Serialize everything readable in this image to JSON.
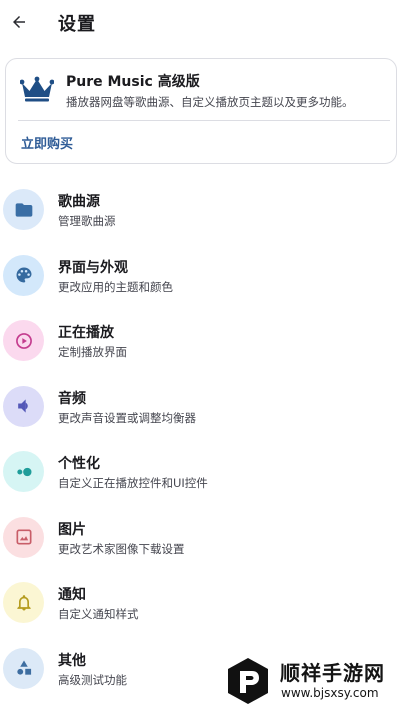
{
  "header": {
    "title": "设置",
    "back_icon": "arrow-back-icon"
  },
  "pro_card": {
    "title": "Pure Music 高级版",
    "description": "播放器网盘等歌曲源、自定义播放页主题以及更多功能。",
    "buy_label": "立即购买",
    "icon": "crown-icon",
    "accent_color": "#1f4e85"
  },
  "settings": {
    "items": [
      {
        "title": "歌曲源",
        "subtitle": "管理歌曲源",
        "icon": "folder-icon",
        "bg_color": "#dbe9f9",
        "icon_color": "#3a6ea5"
      },
      {
        "title": "界面与外观",
        "subtitle": "更改应用的主题和颜色",
        "icon": "palette-icon",
        "bg_color": "#d3e8fb",
        "icon_color": "#356a9f"
      },
      {
        "title": "正在播放",
        "subtitle": "定制播放界面",
        "icon": "play-circle-icon",
        "bg_color": "#fbd9ee",
        "icon_color": "#c43c8e"
      },
      {
        "title": "音频",
        "subtitle": "更改声音设置或调整均衡器",
        "icon": "volume-icon",
        "bg_color": "#dcdcf8",
        "icon_color": "#5458b8"
      },
      {
        "title": "个性化",
        "subtitle": "自定义正在播放控件和UI控件",
        "icon": "toggle-icon",
        "bg_color": "#d6f5f4",
        "icon_color": "#1f9d9a"
      },
      {
        "title": "图片",
        "subtitle": "更改艺术家图像下载设置",
        "icon": "image-icon",
        "bg_color": "#fbdfe1",
        "icon_color": "#c85d68"
      },
      {
        "title": "通知",
        "subtitle": "自定义通知样式",
        "icon": "bell-icon",
        "bg_color": "#fbf6d3",
        "icon_color": "#b59c1f"
      },
      {
        "title": "其他",
        "subtitle": "高级测试功能",
        "icon": "shapes-icon",
        "bg_color": "#dce9f7",
        "icon_color": "#3d6da0"
      }
    ]
  },
  "watermark": {
    "name": "顺祥手游网",
    "url": "www.bjsxsy.com"
  }
}
